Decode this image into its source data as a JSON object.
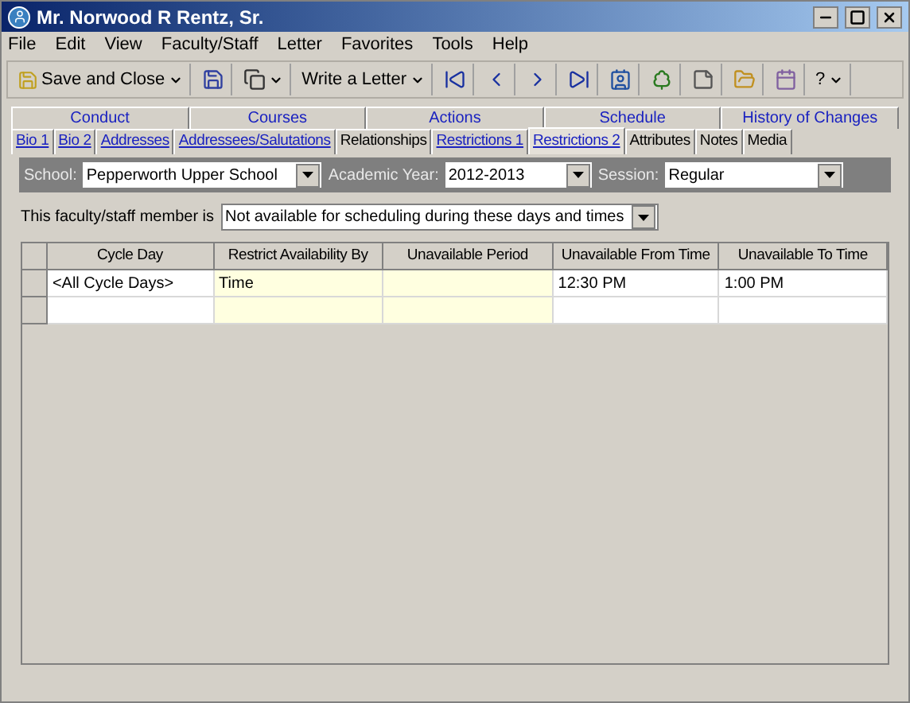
{
  "window": {
    "title": "Mr. Norwood R Rentz, Sr."
  },
  "menu": [
    "File",
    "Edit",
    "View",
    "Faculty/Staff",
    "Letter",
    "Favorites",
    "Tools",
    "Help"
  ],
  "toolbar": [
    {
      "kind": "text",
      "label": "Save and Close",
      "dropdown": true
    },
    {
      "kind": "icon",
      "dropdown": false
    },
    {
      "kind": "icon",
      "dropdown": true
    },
    {
      "kind": "text",
      "label": "Write a Letter",
      "dropdown": true
    },
    {
      "kind": "icon",
      "dropdown": false
    },
    {
      "kind": "icon",
      "dropdown": false
    },
    {
      "kind": "icon",
      "dropdown": false
    },
    {
      "kind": "icon",
      "dropdown": false
    },
    {
      "kind": "icon",
      "dropdown": false
    },
    {
      "kind": "icon",
      "dropdown": false
    },
    {
      "kind": "icon",
      "dropdown": false
    },
    {
      "kind": "icon",
      "dropdown": false
    },
    {
      "kind": "icon",
      "dropdown": false
    },
    {
      "kind": "text",
      "label": "?",
      "dropdown": true
    }
  ],
  "tabs_top": [
    {
      "label": "Conduct",
      "kind": "link"
    },
    {
      "label": "Courses",
      "kind": "link"
    },
    {
      "label": "Actions",
      "kind": "link"
    },
    {
      "label": "Schedule",
      "kind": "link"
    },
    {
      "label": "History of Changes",
      "kind": "link"
    }
  ],
  "tabs": [
    {
      "label": "Bio 1",
      "kind": "link",
      "selected": false
    },
    {
      "label": "Bio 2",
      "kind": "link",
      "selected": false
    },
    {
      "label": "Addresses",
      "kind": "link",
      "selected": false
    },
    {
      "label": "Addressees/Salutations",
      "kind": "link",
      "selected": false
    },
    {
      "label": "Relationships",
      "kind": "plain",
      "selected": false
    },
    {
      "label": "Restrictions 1",
      "kind": "link",
      "selected": false
    },
    {
      "label": "Restrictions 2",
      "kind": "link",
      "selected": true
    },
    {
      "label": "Attributes",
      "kind": "plain",
      "selected": false
    },
    {
      "label": "Notes",
      "kind": "plain",
      "selected": false
    },
    {
      "label": "Media",
      "kind": "plain",
      "selected": false
    }
  ],
  "filters": [
    {
      "label": "School:",
      "value": "Pepperworth Upper School"
    },
    {
      "label": "Academic Year:",
      "value": "2012-2013"
    },
    {
      "label": "Session:",
      "value": "Regular"
    }
  ],
  "availability": {
    "label": "This faculty/staff member is",
    "value": "Not available for scheduling during these days and times"
  },
  "table": {
    "columns": [
      {
        "label": "Cycle Day",
        "highlight": false
      },
      {
        "label": "Restrict Availability By",
        "highlight": true
      },
      {
        "label": "Unavailable Period",
        "highlight": true
      },
      {
        "label": "Unavailable From Time",
        "highlight": false
      },
      {
        "label": "Unavailable To Time",
        "highlight": false
      }
    ],
    "rows": [
      [
        "<All Cycle Days>",
        "Time",
        "",
        "12:30 PM",
        "1:00 PM"
      ],
      [
        "",
        "",
        "",
        "",
        ""
      ]
    ]
  }
}
